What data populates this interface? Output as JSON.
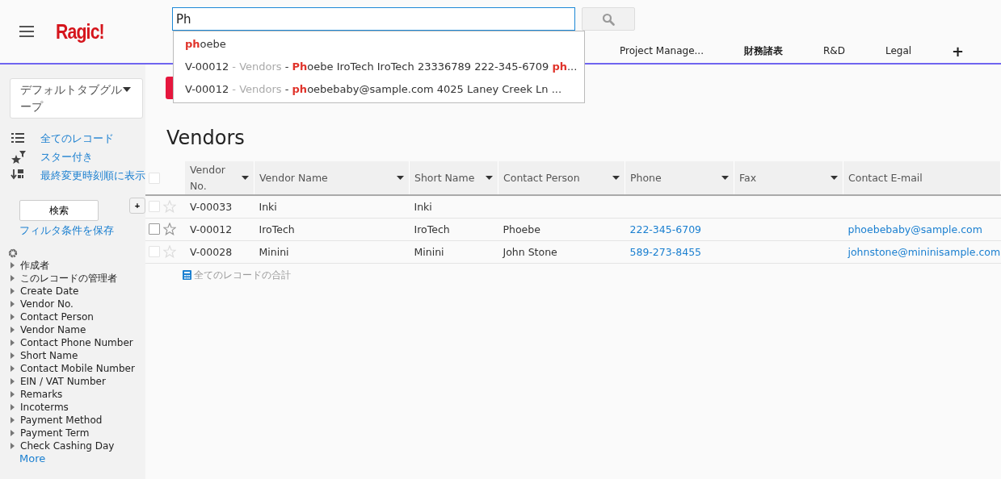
{
  "header": {
    "logo": "Ragic!",
    "search": {
      "value": "Ph"
    },
    "suggestions": [
      {
        "parts": [
          {
            "kind": "match",
            "text": "ph"
          },
          {
            "kind": "plain",
            "text": "oebe"
          }
        ]
      },
      {
        "parts": [
          {
            "kind": "plain",
            "text": "V-00012 "
          },
          {
            "kind": "muted",
            "text": "- Vendors"
          },
          {
            "kind": "plain",
            "text": " - "
          },
          {
            "kind": "match",
            "text": "Ph"
          },
          {
            "kind": "plain",
            "text": "oebe IroTech IroTech 23336789 222-345-6709 "
          },
          {
            "kind": "match",
            "text": "ph"
          },
          {
            "kind": "plain",
            "text": "..."
          }
        ]
      },
      {
        "parts": [
          {
            "kind": "plain",
            "text": "V-00012 "
          },
          {
            "kind": "muted",
            "text": "- Vendors"
          },
          {
            "kind": "plain",
            "text": " - "
          },
          {
            "kind": "match",
            "text": "ph"
          },
          {
            "kind": "plain",
            "text": "oebebaby@sample.com 4025 Laney Creek Ln ..."
          }
        ]
      }
    ],
    "tabs": [
      {
        "label": "Project Manage...",
        "selected": false
      },
      {
        "label": "財務諸表",
        "selected": true
      },
      {
        "label": "R&D",
        "selected": false
      },
      {
        "label": "Legal",
        "selected": false
      }
    ],
    "add_tab": "+"
  },
  "sidebar": {
    "tab_group": "デフォルトタブグループ",
    "views": [
      {
        "kind": "list",
        "label": "全てのレコード"
      },
      {
        "kind": "starred",
        "label": "スター付き"
      },
      {
        "kind": "sorted",
        "label": "最終変更時刻順に表示"
      }
    ],
    "search_button": "検索",
    "add_button": "+",
    "save_filter": "フィルタ条件を保存",
    "fields": [
      "作成者",
      "このレコードの管理者",
      "Create Date",
      "Vendor No.",
      "Contact Person",
      "Vendor Name",
      "Contact Phone Number",
      "Short Name",
      "Contact Mobile Number",
      "EIN / VAT Number",
      "Remarks",
      "Incoterms",
      "Payment Method",
      "Payment Term",
      "Check Cashing Day"
    ],
    "more": "More"
  },
  "main": {
    "title": "Vendors",
    "table": {
      "select_all": {
        "checked": false
      },
      "columns": [
        {
          "label": "Vendor No.",
          "sortable": true,
          "kind": "text"
        },
        {
          "label": "Vendor Name",
          "sortable": true,
          "kind": "text"
        },
        {
          "label": "Short Name",
          "sortable": true,
          "kind": "text"
        },
        {
          "label": "Contact Person",
          "sortable": true,
          "kind": "text"
        },
        {
          "label": "Phone",
          "sortable": true,
          "kind": "phone"
        },
        {
          "label": "Fax",
          "sortable": true
        },
        {
          "label": "Contact E-mail",
          "sortable": false,
          "kind": "email"
        }
      ],
      "rows": [
        {
          "checked": false,
          "hovered": false,
          "starred": false,
          "cells": [
            "V-00033",
            "Inki",
            "Inki",
            "",
            "",
            "",
            ""
          ]
        },
        {
          "checked": false,
          "hovered": true,
          "starred": false,
          "cells": [
            "V-00012",
            "IroTech",
            "IroTech",
            "Phoebe",
            "222-345-6709",
            "",
            "phoebebaby@sample.com"
          ]
        },
        {
          "checked": false,
          "hovered": false,
          "starred": false,
          "cells": [
            "V-00028",
            "Minini",
            "Minini",
            "John Stone",
            "589-273-8455",
            "",
            "johnstone@mininisample.com"
          ]
        }
      ],
      "totals": "全てのレコードの合計"
    }
  }
}
